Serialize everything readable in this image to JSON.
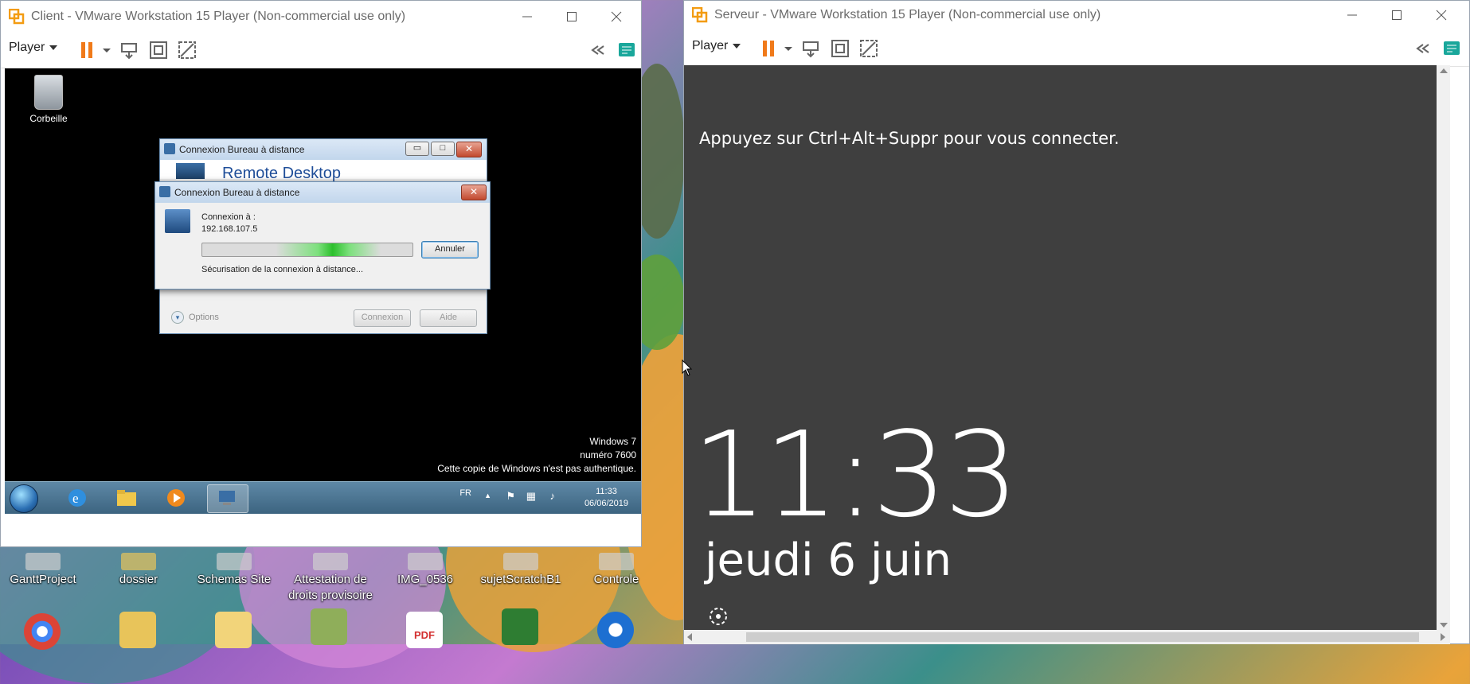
{
  "client_window": {
    "title": "Client - VMware Workstation 15 Player (Non-commercial use only)",
    "player_label": "Player"
  },
  "server_window": {
    "title": "Serveur - VMware Workstation 15 Player (Non-commercial use only)",
    "player_label": "Player"
  },
  "client_guest": {
    "recycle_bin_label": "Corbeille",
    "rdp_window": {
      "title": "Connexion Bureau à distance",
      "heading": "Remote Desktop",
      "options_label": "Options",
      "connect_button": "Connexion",
      "help_button": "Aide"
    },
    "progress_dialog": {
      "title": "Connexion Bureau à distance",
      "connecting_to_label": "Connexion à :",
      "address": "192.168.107.5",
      "cancel_button": "Annuler",
      "status_text": "Sécurisation de la connexion à distance..."
    },
    "watermark": {
      "line1": "Windows 7",
      "line2": "numéro 7600",
      "line3": "Cette copie de Windows n'est pas authentique."
    },
    "taskbar": {
      "language": "FR",
      "time": "11:33",
      "date": "06/06/2019"
    }
  },
  "server_guest": {
    "prompt": "Appuyez sur Ctrl+Alt+Suppr pour vous connecter.",
    "clock": "11:33",
    "date": "jeudi 6 juin"
  },
  "host_desktop": {
    "icons": [
      {
        "label": "GanttProject"
      },
      {
        "label": "dossier"
      },
      {
        "label": "Schemas Site"
      },
      {
        "label": "Attestation de droits provisoire"
      },
      {
        "label": "IMG_0536"
      },
      {
        "label": "sujetScratchB1"
      },
      {
        "label": "Controle"
      }
    ],
    "bottom_icons": [
      {
        "label": "PDF"
      }
    ]
  }
}
